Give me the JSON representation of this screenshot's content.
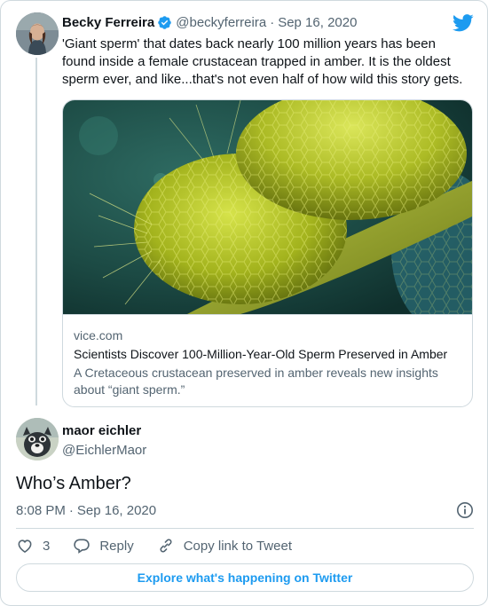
{
  "tweet": {
    "author_name": "Becky Ferreira",
    "handle": "@beckyferreira",
    "separator": "·",
    "date": "Sep 16, 2020",
    "text": "'Giant sperm' that dates back nearly 100 million years has been found inside a female crustacean trapped in amber. It is the oldest sperm ever, and like...that's not even half of how wild this story gets.",
    "link_card": {
      "domain": "vice.com",
      "title": "Scientists Discover 100-Million-Year-Old Sperm Preserved in Amber",
      "description": "A Cretaceous crustacean preserved in amber reveals new insights about “giant sperm.”"
    }
  },
  "reply": {
    "author_name": "maor eichler",
    "handle": "@EichlerMaor",
    "text": "Who’s Amber?",
    "time": "8:08 PM",
    "separator": "·",
    "date": "Sep 16, 2020",
    "like_count": "3",
    "reply_label": "Reply",
    "copy_link_label": "Copy link to Tweet"
  },
  "footer": {
    "explore_label": "Explore what's happening on Twitter"
  },
  "colors": {
    "accent": "#1d9bf0",
    "verified": "#1d9bf0",
    "border": "#cfd9de",
    "secondary_text": "#536471"
  },
  "icons": [
    "twitter-bird-icon",
    "verified-badge-icon",
    "info-icon",
    "heart-icon",
    "reply-bubble-icon",
    "link-icon"
  ]
}
